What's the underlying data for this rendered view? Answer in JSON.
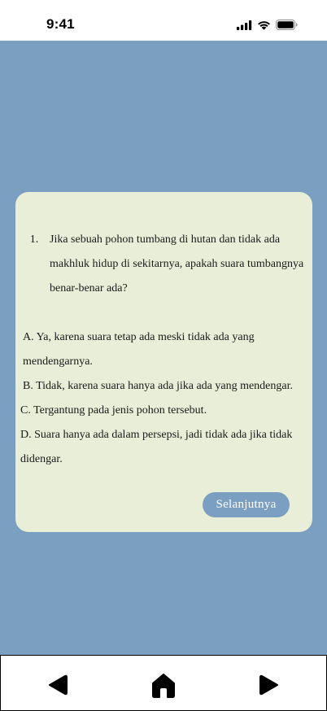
{
  "status_bar": {
    "time": "9:41",
    "icons": [
      "cellular-signal-icon",
      "wifi-icon",
      "battery-icon"
    ]
  },
  "quiz": {
    "question_number": "1.",
    "question_text": "Jika sebuah pohon tumbang di hutan dan tidak ada makhluk hidup di sekitarnya, apakah suara tumbangnya benar-benar ada?",
    "options": {
      "a": "A. Ya, karena suara tetap ada meski tidak ada yang mendengarnya.",
      "b": "B. Tidak, karena suara hanya ada jika ada yang mendengar.",
      "c": "C. Tergantung pada jenis pohon tersebut.",
      "d": "D. Suara hanya ada dalam persepsi, jadi tidak ada jika tidak didengar."
    },
    "next_label": "Selanjutnya"
  },
  "bottom_nav": {
    "icons": [
      "back-arrow-icon",
      "home-icon",
      "forward-arrow-icon"
    ]
  },
  "colors": {
    "background": "#7a9fc0",
    "card": "#e8eed8",
    "button": "#7a9fc0"
  }
}
